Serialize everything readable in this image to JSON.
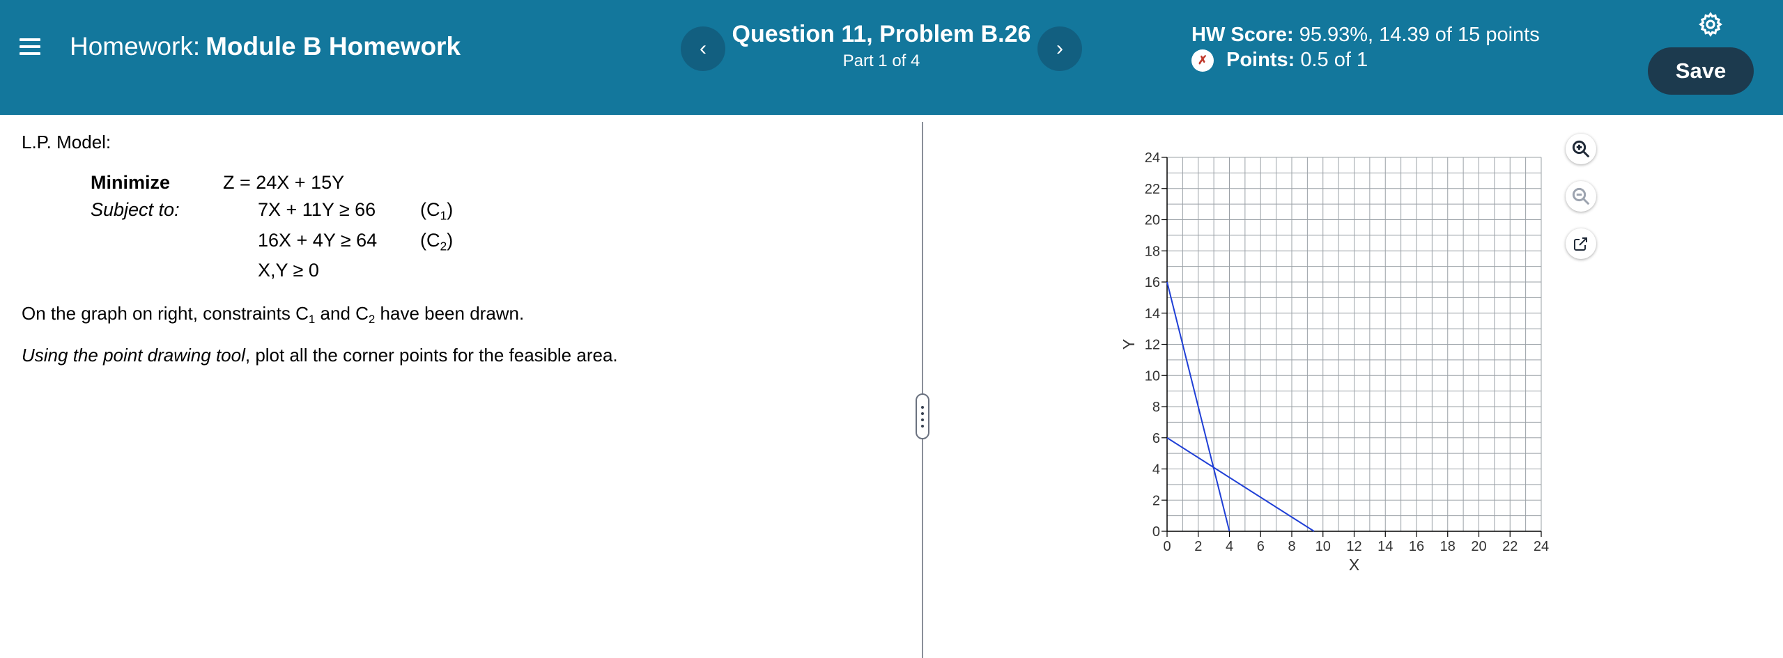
{
  "header": {
    "hw_prefix": "Homework:",
    "hw_name": "Module B Homework",
    "question_title": "Question 11, Problem B.26",
    "question_part": "Part 1 of 4",
    "prev_symbol": "‹",
    "next_symbol": "›",
    "score_label": "HW Score:",
    "score_value": "95.93%, 14.39 of 15 points",
    "points_label": "Points:",
    "points_value": "0.5 of 1",
    "save_label": "Save",
    "bg_color": "#13779c"
  },
  "problem": {
    "lp_label": "L.P. Model:",
    "minimize_label": "Minimize",
    "subject_label": "Subject to:",
    "objective": "Z = 24X + 15Y",
    "c1": "7X + 11Y ≥ 66",
    "c2": "16X + 4Y ≥ 64",
    "nonneg": "X,Y ≥ 0",
    "c1_label": "(C",
    "c1_sub": "1",
    "c2_label": "(C",
    "c2_sub": "2",
    "close_paren": ")",
    "desc1_a": "On the graph on right, constraints C",
    "desc1_sub1": "1",
    "desc1_b": " and C",
    "desc1_sub2": "2",
    "desc1_c": " have been drawn.",
    "desc2_italic": "Using the point drawing tool",
    "desc2_rest": ", plot all the corner points for the feasible area."
  },
  "chart_data": {
    "type": "line",
    "xlabel": "X",
    "ylabel": "Y",
    "xlim": [
      0,
      24
    ],
    "ylim": [
      0,
      24
    ],
    "x_ticks": [
      0,
      2,
      4,
      6,
      8,
      10,
      12,
      14,
      16,
      18,
      20,
      22,
      24
    ],
    "y_ticks": [
      0,
      2,
      4,
      6,
      8,
      10,
      12,
      14,
      16,
      18,
      20,
      22,
      24
    ],
    "minor_step": 1,
    "grid": true,
    "line_color": "#1f3fd6",
    "series": [
      {
        "points": [
          [
            0,
            16
          ],
          [
            4,
            0
          ]
        ]
      },
      {
        "points": [
          [
            0,
            6
          ],
          [
            9.43,
            0
          ]
        ]
      }
    ]
  },
  "tools": {
    "zoom_in": "zoom-in-icon",
    "zoom_out": "zoom-out-icon",
    "popout": "external-link-icon"
  }
}
